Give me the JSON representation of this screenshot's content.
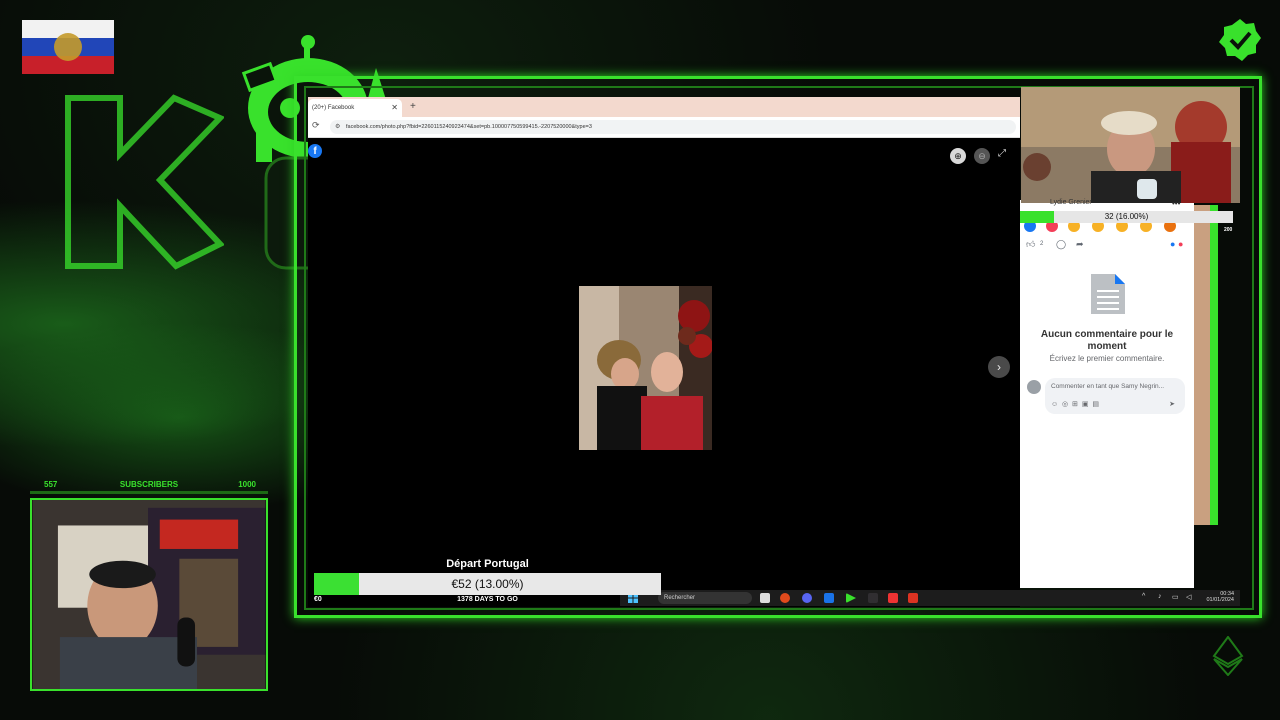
{
  "browser": {
    "tab_title": "(20+) Facebook",
    "tab_close": "✕",
    "new_tab": "+",
    "url": "facebook.com/photo.php?fbid=2260115240923474&set=pb.100007750599415.-2207520000&type=3",
    "reload_icon": "⟳"
  },
  "viewer": {
    "fb_logo": "f",
    "zoom_in": "⊕",
    "zoom_out": "⊖",
    "expand": "⤢",
    "next": "›"
  },
  "goal": {
    "title": "Départ Portugal",
    "amount_text": "€52 (13.00%)",
    "percent": 13.0,
    "left_label": "€0",
    "days_text": "1378 DAYS TO GO",
    "fill_color": "#3be033"
  },
  "taskbar": {
    "search_placeholder": "Rechercher",
    "time": "00:34",
    "date": "01/01/2024"
  },
  "comments_pane": {
    "author_name": "Lydie Grenier",
    "more_icon": "•••",
    "like_count": "2",
    "empty_title": "Aucun commentaire pour le moment",
    "empty_subtitle": "Écrivez le premier commentaire.",
    "comment_placeholder": "Commenter en tant que Samy Negrin...",
    "tool_icons": [
      "☺",
      "◎",
      "⊞",
      "▣",
      "▤"
    ]
  },
  "follower_goal": {
    "text": "32 (16.00%)",
    "percent": 16.0,
    "max": "200"
  },
  "subscribers": {
    "current": "557",
    "label": "SUBSCRIBERS",
    "goal": "1000"
  },
  "colors": {
    "accent_green": "#39e12c",
    "facebook_blue": "#1877f2"
  }
}
